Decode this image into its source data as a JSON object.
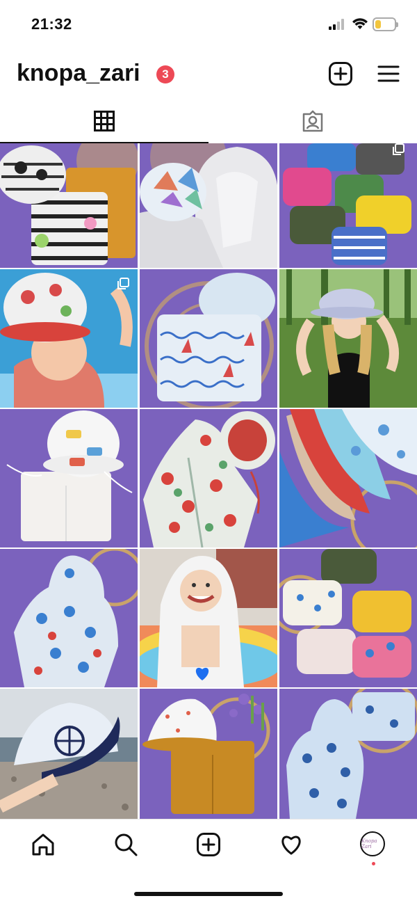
{
  "status_bar": {
    "time": "21:32",
    "battery_level": 0.3
  },
  "header": {
    "username": "knopa_zari",
    "notification_count": "3"
  },
  "tabs": [
    {
      "icon": "grid-icon",
      "active": true
    },
    {
      "icon": "tagged-icon",
      "active": false
    }
  ],
  "posts": [
    {
      "subject": "Panda bucket hat with striped shorts and mustard shorts",
      "multi": false
    },
    {
      "subject": "Paper-boat bucket hat with white linen hooded shirt",
      "multi": false
    },
    {
      "subject": "Colorful baby bloomers",
      "multi": true
    },
    {
      "subject": "Child in watermelon bucket hat by the pool",
      "multi": true
    },
    {
      "subject": "Sailboat print hat and shorts set",
      "multi": false
    },
    {
      "subject": "Woman wearing lavender bucket hat outdoors",
      "multi": false
    },
    {
      "subject": "Car print bucket hat with white shorts",
      "multi": false
    },
    {
      "subject": "Watermelon print hooded poncho with hat",
      "multi": false
    },
    {
      "subject": "Stack of reversible bucket hats",
      "multi": false
    },
    {
      "subject": "Fish print hooded poncho",
      "multi": false
    },
    {
      "subject": "Laughing baby in hooded towel in pool",
      "multi": false
    },
    {
      "subject": "Assorted printed baby bloomers",
      "multi": false
    },
    {
      "subject": "Helm print bucket hat at the seaside",
      "multi": false
    },
    {
      "subject": "Polka dot bucket hat with mustard shorts",
      "multi": false
    },
    {
      "subject": "Blue sailor print hooded poncho and shorts",
      "multi": false
    }
  ],
  "tab_bar": {
    "items": [
      "home-icon",
      "search-icon",
      "new-post-icon",
      "activity-heart-icon",
      "profile-avatar"
    ],
    "avatar_text": "Knopa Zari"
  },
  "colors": {
    "accent_badge": "#ed4956",
    "purple_background": "#7a5fb8"
  }
}
